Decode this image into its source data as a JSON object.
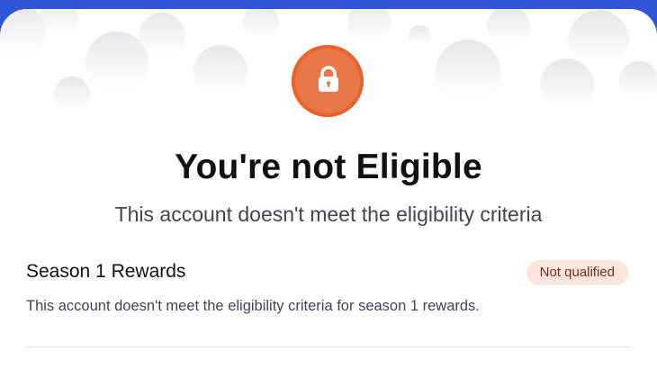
{
  "dialog": {
    "title": "You're not Eligible",
    "subtitle": "This account doesn't meet the eligibility criteria",
    "icon": "lock-icon",
    "accent_color": "#e9632f"
  },
  "reward": {
    "title": "Season 1 Rewards",
    "status": "Not qualified",
    "status_bg": "#fbe5dc",
    "description": "This account doesn't meet the eligibility criteria for season 1 rewards."
  }
}
